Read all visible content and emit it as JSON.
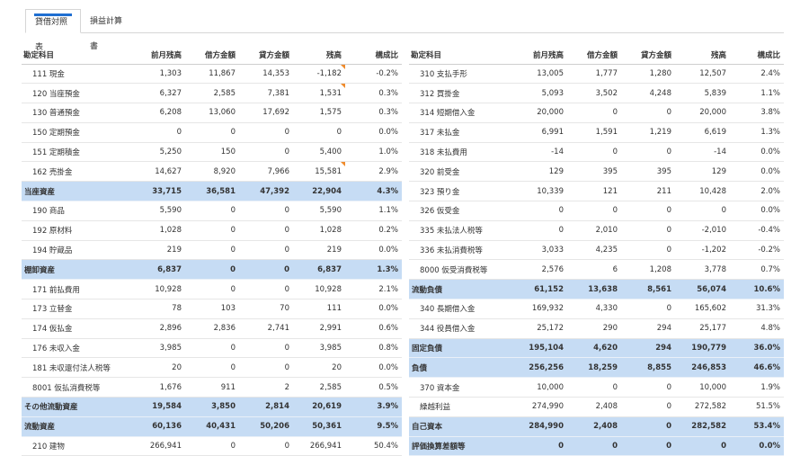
{
  "tabs": [
    {
      "label": "貸借対照表",
      "active": true
    },
    {
      "label": "損益計算書",
      "active": false
    }
  ],
  "columns": [
    "勘定科目",
    "前月残高",
    "借方金額",
    "貸方金額",
    "残高",
    "構成比"
  ],
  "accent_color": "#1f6fd1",
  "subtotal_color": "#c6dcf4",
  "left_rows": [
    {
      "cells": [
        "111 現金",
        "1,303",
        "11,867",
        "14,353",
        "-1,182",
        "-0.2%"
      ],
      "subtotal": false,
      "flag": true
    },
    {
      "cells": [
        "120 当座預金",
        "6,327",
        "2,585",
        "7,381",
        "1,531",
        "0.3%"
      ],
      "subtotal": false,
      "flag": true
    },
    {
      "cells": [
        "130 普通預金",
        "6,208",
        "13,060",
        "17,692",
        "1,575",
        "0.3%"
      ],
      "subtotal": false,
      "flag": false
    },
    {
      "cells": [
        "150 定期預金",
        "0",
        "0",
        "0",
        "0",
        "0.0%"
      ],
      "subtotal": false,
      "flag": false
    },
    {
      "cells": [
        "151 定期積金",
        "5,250",
        "150",
        "0",
        "5,400",
        "1.0%"
      ],
      "subtotal": false,
      "flag": false
    },
    {
      "cells": [
        "162 売掛金",
        "14,627",
        "8,920",
        "7,966",
        "15,581",
        "2.9%"
      ],
      "subtotal": false,
      "flag": true
    },
    {
      "cells": [
        "当座資産",
        "33,715",
        "36,581",
        "47,392",
        "22,904",
        "4.3%"
      ],
      "subtotal": true,
      "flag": false
    },
    {
      "cells": [
        "190 商品",
        "5,590",
        "0",
        "0",
        "5,590",
        "1.1%"
      ],
      "subtotal": false,
      "flag": false
    },
    {
      "cells": [
        "192 原材料",
        "1,028",
        "0",
        "0",
        "1,028",
        "0.2%"
      ],
      "subtotal": false,
      "flag": false
    },
    {
      "cells": [
        "194 貯蔵品",
        "219",
        "0",
        "0",
        "219",
        "0.0%"
      ],
      "subtotal": false,
      "flag": false
    },
    {
      "cells": [
        "棚卸資産",
        "6,837",
        "0",
        "0",
        "6,837",
        "1.3%"
      ],
      "subtotal": true,
      "flag": false
    },
    {
      "cells": [
        "171 前払費用",
        "10,928",
        "0",
        "0",
        "10,928",
        "2.1%"
      ],
      "subtotal": false,
      "flag": false
    },
    {
      "cells": [
        "173 立替金",
        "78",
        "103",
        "70",
        "111",
        "0.0%"
      ],
      "subtotal": false,
      "flag": false
    },
    {
      "cells": [
        "174 仮払金",
        "2,896",
        "2,836",
        "2,741",
        "2,991",
        "0.6%"
      ],
      "subtotal": false,
      "flag": false
    },
    {
      "cells": [
        "176 未収入金",
        "3,985",
        "0",
        "0",
        "3,985",
        "0.8%"
      ],
      "subtotal": false,
      "flag": false
    },
    {
      "cells": [
        "181 未収還付法人税等",
        "20",
        "0",
        "0",
        "20",
        "0.0%"
      ],
      "subtotal": false,
      "flag": false
    },
    {
      "cells": [
        "8001 仮払消費税等",
        "1,676",
        "911",
        "2",
        "2,585",
        "0.5%"
      ],
      "subtotal": false,
      "flag": false
    },
    {
      "cells": [
        "その他流動資産",
        "19,584",
        "3,850",
        "2,814",
        "20,619",
        "3.9%"
      ],
      "subtotal": true,
      "flag": false
    },
    {
      "cells": [
        "流動資産",
        "60,136",
        "40,431",
        "50,206",
        "50,361",
        "9.5%"
      ],
      "subtotal": true,
      "flag": false
    },
    {
      "cells": [
        "210 建物",
        "266,941",
        "0",
        "0",
        "266,941",
        "50.4%"
      ],
      "subtotal": false,
      "flag": false
    }
  ],
  "right_rows": [
    {
      "cells": [
        "310 支払手形",
        "13,005",
        "1,777",
        "1,280",
        "12,507",
        "2.4%"
      ],
      "subtotal": false,
      "flag": false
    },
    {
      "cells": [
        "312 買掛金",
        "5,093",
        "3,502",
        "4,248",
        "5,839",
        "1.1%"
      ],
      "subtotal": false,
      "flag": false
    },
    {
      "cells": [
        "314 短期借入金",
        "20,000",
        "0",
        "0",
        "20,000",
        "3.8%"
      ],
      "subtotal": false,
      "flag": false
    },
    {
      "cells": [
        "317 未払金",
        "6,991",
        "1,591",
        "1,219",
        "6,619",
        "1.3%"
      ],
      "subtotal": false,
      "flag": false
    },
    {
      "cells": [
        "318 未払費用",
        "-14",
        "0",
        "0",
        "-14",
        "0.0%"
      ],
      "subtotal": false,
      "flag": false
    },
    {
      "cells": [
        "320 前受金",
        "129",
        "395",
        "395",
        "129",
        "0.0%"
      ],
      "subtotal": false,
      "flag": false
    },
    {
      "cells": [
        "323 預り金",
        "10,339",
        "121",
        "211",
        "10,428",
        "2.0%"
      ],
      "subtotal": false,
      "flag": false
    },
    {
      "cells": [
        "326 仮受金",
        "0",
        "0",
        "0",
        "0",
        "0.0%"
      ],
      "subtotal": false,
      "flag": false
    },
    {
      "cells": [
        "335 未払法人税等",
        "0",
        "2,010",
        "0",
        "-2,010",
        "-0.4%"
      ],
      "subtotal": false,
      "flag": false
    },
    {
      "cells": [
        "336 未払消費税等",
        "3,033",
        "4,235",
        "0",
        "-1,202",
        "-0.2%"
      ],
      "subtotal": false,
      "flag": false
    },
    {
      "cells": [
        "8000 仮受消費税等",
        "2,576",
        "6",
        "1,208",
        "3,778",
        "0.7%"
      ],
      "subtotal": false,
      "flag": false
    },
    {
      "cells": [
        "流動負債",
        "61,152",
        "13,638",
        "8,561",
        "56,074",
        "10.6%"
      ],
      "subtotal": true,
      "flag": false
    },
    {
      "cells": [
        "340 長期借入金",
        "169,932",
        "4,330",
        "0",
        "165,602",
        "31.3%"
      ],
      "subtotal": false,
      "flag": false
    },
    {
      "cells": [
        "344 役員借入金",
        "25,172",
        "290",
        "294",
        "25,177",
        "4.8%"
      ],
      "subtotal": false,
      "flag": false
    },
    {
      "cells": [
        "固定負債",
        "195,104",
        "4,620",
        "294",
        "190,779",
        "36.0%"
      ],
      "subtotal": true,
      "flag": false
    },
    {
      "cells": [
        "負債",
        "256,256",
        "18,259",
        "8,855",
        "246,853",
        "46.6%"
      ],
      "subtotal": true,
      "flag": false
    },
    {
      "cells": [
        "370 資本金",
        "10,000",
        "0",
        "0",
        "10,000",
        "1.9%"
      ],
      "subtotal": false,
      "flag": false
    },
    {
      "cells": [
        "繰越利益",
        "274,990",
        "2,408",
        "0",
        "272,582",
        "51.5%"
      ],
      "subtotal": false,
      "flag": false
    },
    {
      "cells": [
        "自己資本",
        "284,990",
        "2,408",
        "0",
        "282,582",
        "53.4%"
      ],
      "subtotal": true,
      "flag": false
    },
    {
      "cells": [
        "評価換算差額等",
        "0",
        "0",
        "0",
        "0",
        "0.0%"
      ],
      "subtotal": true,
      "flag": false
    }
  ]
}
